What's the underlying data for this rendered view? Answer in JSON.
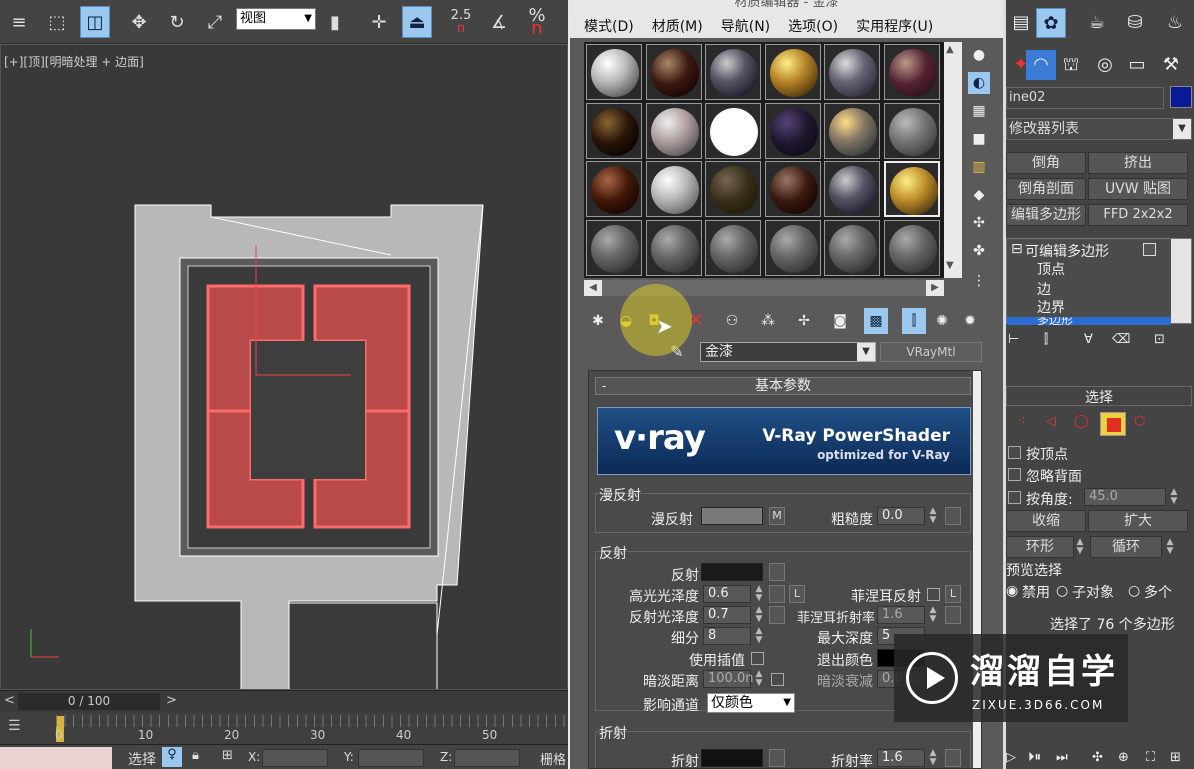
{
  "topbar": {
    "view_select": "视图",
    "snap_angle": "2.5",
    "snap_angle_dim": "n",
    "snap_percent": "%",
    "snap_percent_dim": "n"
  },
  "viewport": {
    "label_a": "[+]",
    "label_b": "[顶]",
    "label_c": "[明暗处理 + 边面]"
  },
  "timeline": {
    "frame": "0 / 100",
    "prev": "<",
    "next": ">",
    "ticks": [
      "0",
      "10",
      "20",
      "30",
      "40",
      "50"
    ]
  },
  "statusbar": {
    "select_label": "选择",
    "x_label": "X:",
    "y_label": "Y:",
    "z_label": "Z:",
    "grid_label": "栅格"
  },
  "material_editor": {
    "title": "材质编辑器 - 金漆",
    "menu": [
      "模式(D)",
      "材质(M)",
      "导航(N)",
      "选项(O)",
      "实用程序(U)"
    ],
    "material_name": "金漆",
    "material_type": "VRayMtl",
    "rollout_title": "基本参数",
    "rollout_minus": "-",
    "banner": {
      "logo": "v·ray",
      "title": "V-Ray PowerShader",
      "subtitle": "optimized for V-Ray"
    },
    "diffuse": {
      "group": "漫反射",
      "label": "漫反射",
      "map_btn": "M",
      "roughness_label": "粗糙度",
      "roughness": "0.0"
    },
    "reflection": {
      "group": "反射",
      "label": "反射",
      "hilight_gloss_label": "高光光泽度",
      "hilight_gloss": "0.6",
      "lock_btn": "L",
      "fresnel_label": "菲涅耳反射",
      "fresnel_lock": "L",
      "refl_gloss_label": "反射光泽度",
      "refl_gloss": "0.7",
      "fresnel_ior_label": "菲涅耳折射率",
      "fresnel_ior": "1.6",
      "subdivs_label": "细分",
      "subdivs": "8",
      "max_depth_label": "最大深度",
      "max_depth": "5",
      "use_interp_label": "使用插值",
      "exit_color_label": "退出颜色",
      "dim_dist_label": "暗淡距离",
      "dim_dist": "100.0n",
      "dim_falloff_label": "暗淡衰减",
      "dim_falloff": "0.0",
      "affect_channels_label": "影响通道",
      "affect_channels": "仅颜色"
    },
    "refraction": {
      "group": "折射",
      "label": "折射",
      "ior_label": "折射率",
      "ior": "1.6"
    },
    "colors": {
      "diffuse": "#7a7a7a",
      "reflect": "#1a1a1a",
      "refract": "#111111",
      "exit": "#000000"
    }
  },
  "command_panel": {
    "object_name": "ine02",
    "modifier_list": "修改器列表",
    "buttons": [
      "倒角",
      "挤出",
      "倒角剖面",
      "UVW 贴图",
      "编辑多边形",
      "FFD 2x2x2"
    ],
    "stack": {
      "root": "可编辑多边形",
      "items": [
        "顶点",
        "边",
        "边界",
        "多边形"
      ]
    },
    "selection": {
      "title": "选择",
      "by_vertex": "按顶点",
      "ignore_backface": "忽略背面",
      "by_angle": "按角度:",
      "angle_value": "45.0",
      "shrink": "收缩",
      "grow": "扩大",
      "ring": "环形",
      "loop": "循环",
      "preview_title": "预览选择",
      "preview_opts": [
        "禁用",
        "子对象",
        "多个"
      ],
      "status": "选择了 76 个多边形"
    },
    "colors": {
      "object_color": "#0a1a96",
      "active_subobj": "#e03020"
    }
  },
  "watermark": {
    "brand": "溜溜自学",
    "url": "ZIXUE.3D66.COM"
  }
}
